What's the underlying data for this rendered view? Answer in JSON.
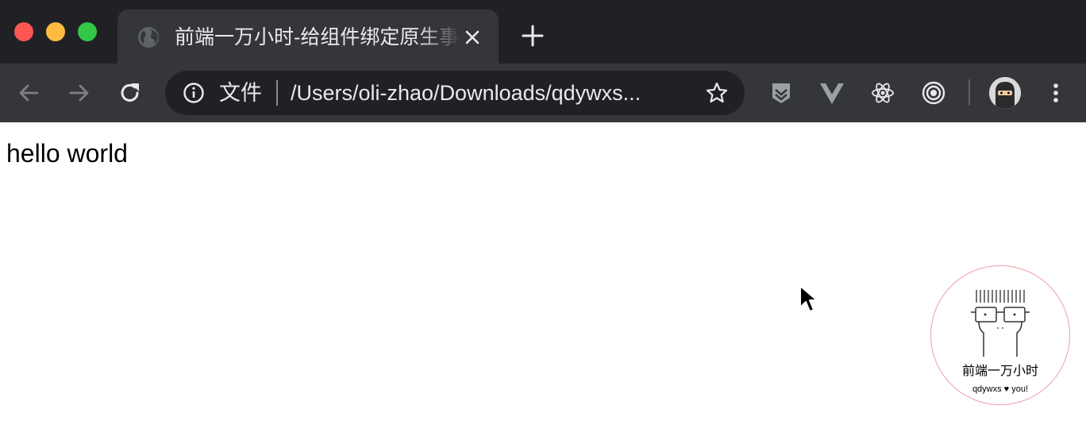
{
  "window": {
    "controls": [
      "close",
      "minimize",
      "zoom"
    ]
  },
  "tab": {
    "title": "前端一万小时-给组件绑定原生事",
    "favicon": "globe-icon"
  },
  "toolbar": {
    "back_icon": "back-arrow-icon",
    "forward_icon": "forward-arrow-icon",
    "reload_icon": "reload-icon",
    "omnibox": {
      "scheme_label": "文件",
      "url": "/Users/oli-zhao/Downloads/qdywxs..."
    },
    "extensions": [
      "shield-extension-icon",
      "vue-devtools-icon",
      "react-devtools-icon",
      "target-extension-icon"
    ]
  },
  "page": {
    "text": "hello world"
  },
  "watermark": {
    "title": "前端一万小时",
    "subtitle": "qdywxs ♥ you!"
  },
  "colors": {
    "titlebar": "#202124",
    "toolbar": "#35363a",
    "omnibox": "#202124",
    "close": "#fc5753",
    "minimize": "#fdbc40",
    "zoom": "#33c748",
    "watermark_border": "#f0a0a8"
  }
}
